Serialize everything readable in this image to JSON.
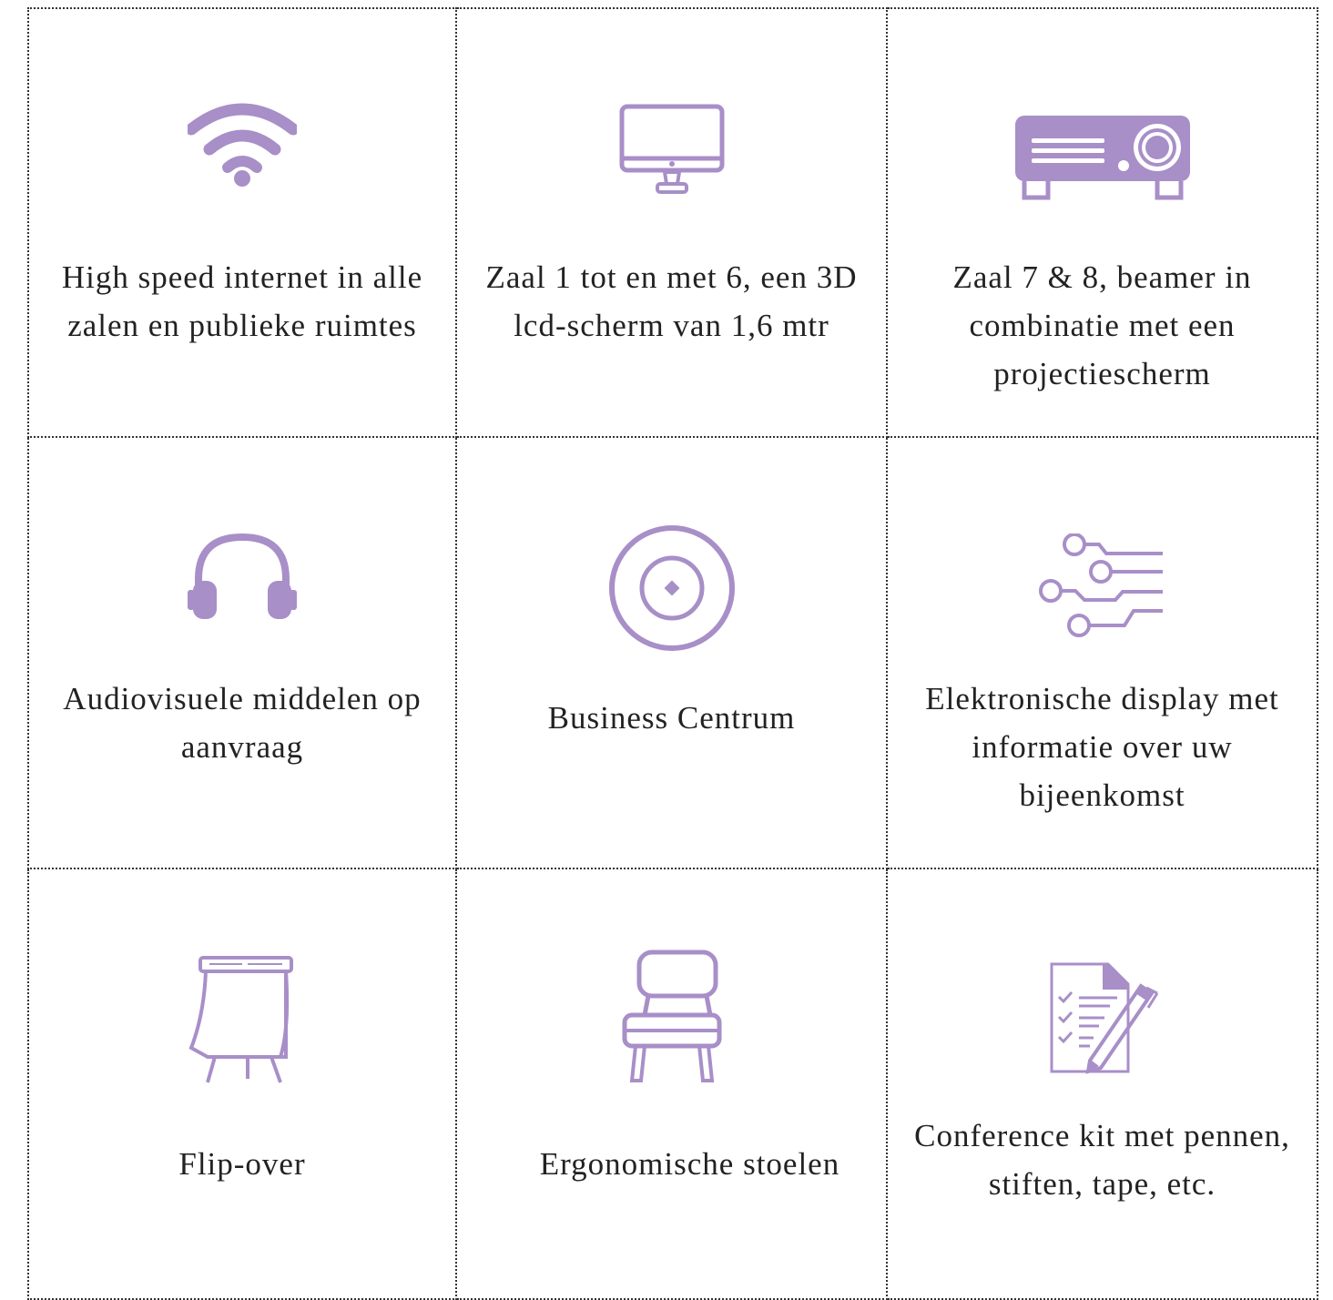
{
  "accent_color": "#a88fc8",
  "cells": [
    {
      "label": "High speed internet in alle zalen en publieke ruimtes",
      "icon": "wifi-icon"
    },
    {
      "label": "Zaal 1 tot en met 6, een 3D lcd-scherm van 1,6 mtr",
      "icon": "monitor-icon"
    },
    {
      "label": "Zaal 7 & 8, beamer in combinatie met een projectiescherm",
      "icon": "projector-icon"
    },
    {
      "label": "Audiovisuele middelen op aanvraag",
      "icon": "headphones-icon"
    },
    {
      "label": "Business Centrum",
      "icon": "target-icon"
    },
    {
      "label": "Elektronische display met informatie over uw bijeenkomst",
      "icon": "circuit-icon"
    },
    {
      "label": "Flip-over",
      "icon": "flipchart-icon"
    },
    {
      "label": "Ergonomische stoelen",
      "icon": "chair-icon"
    },
    {
      "label": "Conference kit met pennen, stiften, tape, etc.",
      "icon": "document-pen-icon"
    }
  ]
}
